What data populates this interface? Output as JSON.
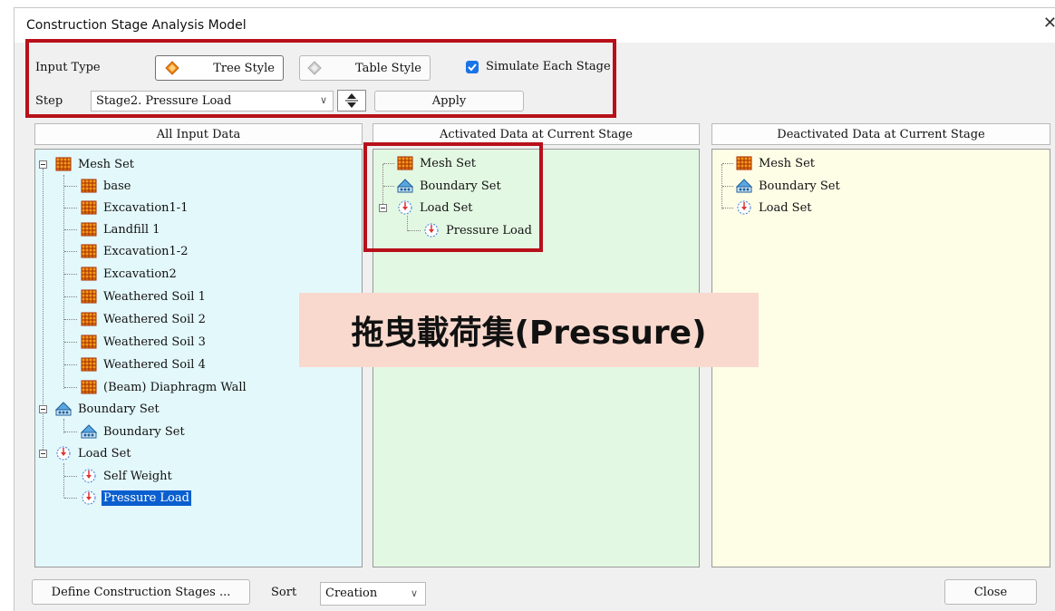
{
  "window": {
    "title": "Construction Stage Analysis Model"
  },
  "input_type": {
    "label": "Input Type",
    "tree_style": "Tree Style",
    "table_style": "Table Style",
    "simulate": "Simulate Each Stage"
  },
  "step": {
    "label": "Step",
    "value": "Stage2. Pressure Load",
    "apply": "Apply"
  },
  "panels": {
    "all": {
      "header": "All Input Data",
      "mesh_set": "Mesh Set",
      "mesh_items": [
        "base",
        "Excavation1-1",
        "Landfill 1",
        "Excavation1-2",
        "Excavation2",
        "Weathered Soil 1",
        "Weathered Soil 2",
        "Weathered Soil 3",
        "Weathered Soil 4",
        "(Beam) Diaphragm Wall"
      ],
      "boundary_set": "Boundary Set",
      "boundary_items": [
        "Boundary Set"
      ],
      "load_set": "Load Set",
      "load_items": [
        "Self Weight",
        "Pressure Load"
      ]
    },
    "activated": {
      "header": "Activated Data at Current Stage",
      "items": [
        "Mesh Set",
        "Boundary Set",
        "Load Set",
        "Pressure Load"
      ]
    },
    "deactivated": {
      "header": "Deactivated Data at Current Stage",
      "items": [
        "Mesh Set",
        "Boundary Set",
        "Load Set"
      ]
    }
  },
  "footer": {
    "define": "Define Construction Stages ...",
    "sort_label": "Sort",
    "sort_value": "Creation",
    "close": "Close"
  },
  "overlay_text": "拖曳載荷集(Pressure)",
  "colors": {
    "highlight_box": "#b8101a",
    "all_bg": "#e3f8fb",
    "activated_bg": "#e3f8e3",
    "deactivated_bg": "#fefde6",
    "selection": "#0a5fcf",
    "accent": "#1a73e8"
  }
}
